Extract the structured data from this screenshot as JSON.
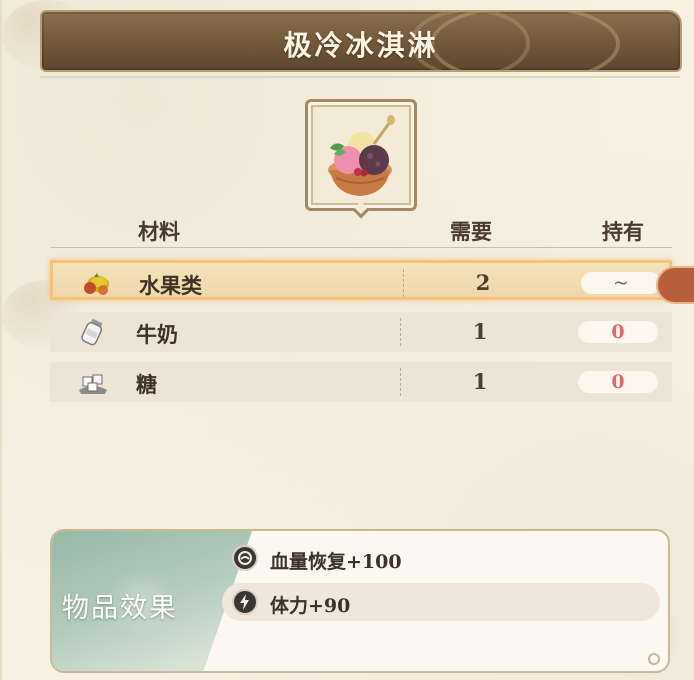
{
  "title": "极冷冰淇淋",
  "table": {
    "headers": {
      "material": "材料",
      "need": "需要",
      "hold": "持有"
    },
    "rows": [
      {
        "icon": "fruit-icon",
        "name": "水果类",
        "need": "2",
        "hold": "~",
        "selected": true
      },
      {
        "icon": "milk-bottle-icon",
        "name": "牛奶",
        "need": "1",
        "hold": "0",
        "selected": false
      },
      {
        "icon": "sugar-cubes-icon",
        "name": "糖",
        "need": "1",
        "hold": "0",
        "selected": false
      }
    ]
  },
  "effects": {
    "label": "物品效果",
    "items": [
      {
        "icon": "health-restore-icon",
        "text": "血量恢复+100"
      },
      {
        "icon": "stamina-bolt-icon",
        "text": "体力+90"
      }
    ]
  },
  "colors": {
    "title_bg": "#6f5638",
    "selected_border": "#f3c27e",
    "zero_count": "#e06a6a",
    "effect_panel": "#98b8a6",
    "side_tab": "#b95e3d"
  }
}
